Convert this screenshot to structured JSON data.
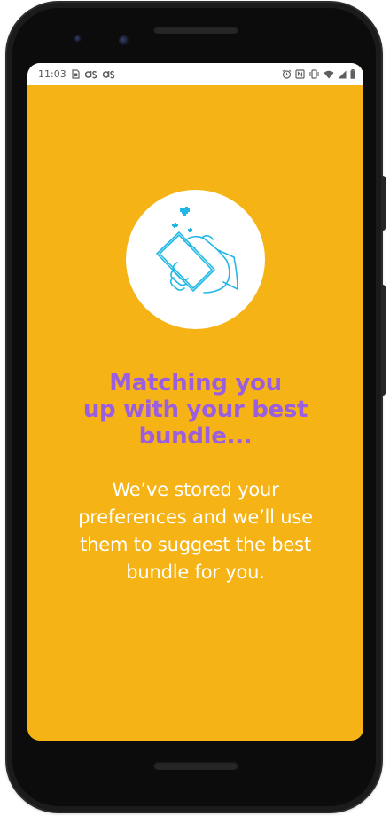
{
  "status_bar": {
    "time": "11:03",
    "left_icons": [
      "sim-card-icon",
      "notification-ds-icon",
      "notification-ds-icon"
    ],
    "right_icons": [
      "alarm-icon",
      "nfc-icon",
      "vibrate-icon",
      "wifi-icon",
      "signal-icon",
      "battery-icon"
    ]
  },
  "main": {
    "illustration_icon": "hand-holding-phone-hearts-icon",
    "headline": "Matching you up with your best bundle...",
    "headline_lines": [
      "Matching you",
      "up with your best",
      "bundle..."
    ],
    "body": "We’ve stored your preferences and we’ll use them to suggest the best bundle for you.",
    "body_lines": [
      "We’ve stored your",
      "preferences and we’ll use",
      "them to suggest the best",
      "bundle for you."
    ]
  },
  "colors": {
    "background": "#f5b315",
    "headline": "#9b5ee0",
    "body_text": "#ffffff",
    "illustration_stroke": "#22b8e6",
    "status_bar": "#ffffff"
  }
}
